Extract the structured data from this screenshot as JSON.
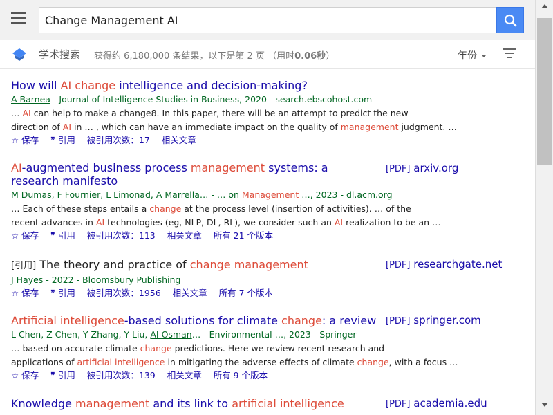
{
  "search": {
    "query": "Change Management AI"
  },
  "subbar": {
    "section_title": "学术搜索",
    "stats_prefix": "获得约 6,180,000 条结果，以下是第 2 页 （用时",
    "stats_time": "0.06秒",
    "stats_suffix": "）",
    "year_filter": "年份"
  },
  "results": [
    {
      "title": [
        "How will ",
        "AI",
        " ",
        "change",
        " intelligence and decision-making?"
      ],
      "authors": {
        "linked": "A Barnea",
        "rest": " - Journal of Intelligence Studies in Business, 2020 - search.ebscohost.com"
      },
      "snippet1": [
        "… ",
        "AI",
        " can help to make a change8. In this paper, there will be an attempt to predict the new"
      ],
      "snippet2": [
        "direction of ",
        "AI",
        " in … , which can have an immediate impact on the quality of ",
        "management",
        " judgment. …"
      ],
      "actions": [
        "☆ 保存",
        "❞ 引用",
        "被引用次数：17",
        "相关文章"
      ]
    },
    {
      "title": [
        "AI",
        "-augmented business process ",
        "management",
        " systems: a research manifesto"
      ],
      "side": {
        "pdf": "[PDF]",
        "site": " arxiv.org"
      },
      "authors": {
        "a1": "M Dumas",
        "a2": "F Fournier",
        "a3": "L Limonad",
        "a4": "A Marrella",
        "mid": "… - … on ",
        "hl": "Management",
        "rest": " …, 2023 - dl.acm.org"
      },
      "snippet1": [
        "… Each of these steps entails a ",
        "change",
        " at the process level (insertion of activities). … of the"
      ],
      "snippet2": [
        "recent advances in ",
        "AI",
        " technologies (eg, NLP, DL, RL), we consider such an ",
        "AI",
        " realization to be an …"
      ],
      "actions": [
        "☆ 保存",
        "❞ 引用",
        "被引用次数：113",
        "相关文章",
        "所有 21 个版本"
      ]
    },
    {
      "tag": "[引用]",
      "title": [
        " The theory and practice of ",
        "change management"
      ],
      "side": {
        "pdf": "[PDF]",
        "site": " researchgate.net"
      },
      "authors": {
        "linked": "J Hayes",
        "rest": " - 2022 - Bloomsbury Publishing"
      },
      "actions": [
        "☆ 保存",
        "❞ 引用",
        "被引用次数：1956",
        "相关文章",
        "所有 7 个版本"
      ]
    },
    {
      "title": [
        "Artificial intelligence",
        "-based solutions for climate ",
        "change",
        ": a review"
      ],
      "side": {
        "pdf": "[PDF]",
        "site": " springer.com"
      },
      "authors": {
        "plain": "L Chen, Z Chen, Y Zhang, Y Liu, ",
        "linked": "AI Osman",
        "rest": "… - Environmental …, 2023 - Springer"
      },
      "snippet1": [
        "… based on accurate climate ",
        "change",
        " predictions. Here we review recent research and"
      ],
      "snippet2": [
        "applications of ",
        "artificial intelligence",
        " in mitigating the adverse effects of climate ",
        "change",
        ", with a focus …"
      ],
      "actions": [
        "☆ 保存",
        "❞ 引用",
        "被引用次数：139",
        "相关文章",
        "所有 9 个版本"
      ]
    },
    {
      "title": [
        "Knowledge ",
        "management",
        " and its link to ",
        "artificial intelligence"
      ],
      "side": {
        "pdf": "[PDF]",
        "site": " academia.edu"
      }
    }
  ]
}
